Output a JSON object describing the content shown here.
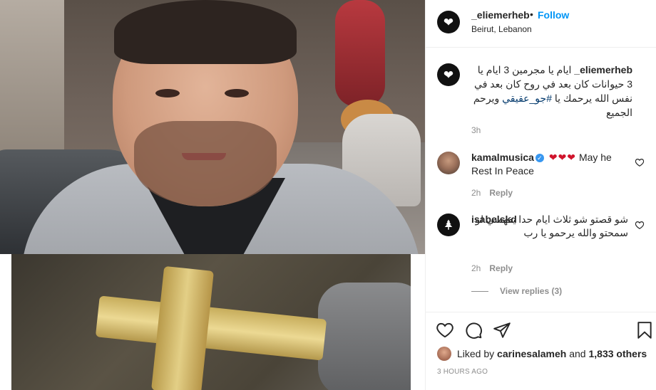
{
  "post": {
    "username": "_eliemerheb",
    "separator": "•",
    "follow_label": "Follow",
    "location": "Beirut, Lebanon"
  },
  "caption": {
    "username": "_eliemerheb",
    "text_before_tag": "ايام يا مجرمين 3 ايام يا 3 حيوانات كان بعد في روح كان بعد في نفس الله يرحمك يا ",
    "hashtag": "#جو_عقيقي",
    "text_after_tag": " ويرحم الجميع",
    "time": "3h"
  },
  "comments": [
    {
      "username": "kamalmusica",
      "verified_icon": "verified-badge-icon",
      "hearts": "❤❤❤",
      "text": "May he Rest In Peace",
      "time": "2h",
      "reply_label": "Reply"
    },
    {
      "username": "isabelskd",
      "text": "شو قصتو شو ثلاث ايام حدا يفهمني لو سمحتو والله يرحمو يا رب",
      "time": "2h",
      "reply_label": "Reply",
      "view_replies": "View replies (3)"
    }
  ],
  "footer": {
    "liked_by_prefix": "Liked by ",
    "liked_by_user": "carinesalameh",
    "liked_by_middle": " and ",
    "liked_by_count": "1,833 others",
    "timestamp": "3 hours ago"
  },
  "icons": {
    "like": "heart-outline-icon",
    "comment": "speech-bubble-icon",
    "share": "paper-plane-icon",
    "save": "bookmark-icon",
    "comment_like": "small-heart-icon",
    "avatar_logo": "white-heart-logo-icon",
    "cedar": "cedar-tree-icon"
  },
  "colors": {
    "link_blue": "#0095f6",
    "hashtag": "#00376b",
    "muted": "#8e8e8e",
    "heart_red": "#d0142c",
    "verified": "#3897f0"
  }
}
